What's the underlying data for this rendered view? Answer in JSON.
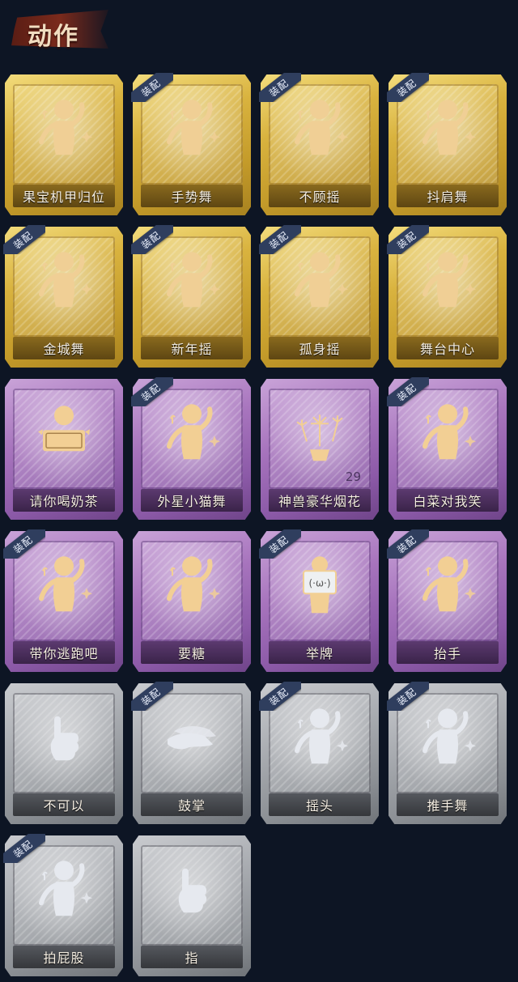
{
  "header": {
    "title": "动作"
  },
  "equip_label": "装配",
  "cards": [
    {
      "name": "果宝机甲归位",
      "tier": "gold",
      "equipped": false,
      "icon": "character-pose-icon"
    },
    {
      "name": "手势舞",
      "tier": "gold",
      "equipped": true,
      "icon": "character-dance-icon"
    },
    {
      "name": "不顾摇",
      "tier": "gold",
      "equipped": true,
      "icon": "character-point-icon"
    },
    {
      "name": "抖肩舞",
      "tier": "gold",
      "equipped": true,
      "icon": "character-shrug-icon"
    },
    {
      "name": "金城舞",
      "tier": "gold",
      "equipped": true,
      "icon": "character-wave-icon"
    },
    {
      "name": "新年摇",
      "tier": "gold",
      "equipped": true,
      "icon": "character-sway-icon"
    },
    {
      "name": "孤身摇",
      "tier": "gold",
      "equipped": true,
      "icon": "character-solo-icon"
    },
    {
      "name": "舞台中心",
      "tier": "gold",
      "equipped": true,
      "icon": "character-stage-icon"
    },
    {
      "name": "请你喝奶茶",
      "tier": "purple",
      "equipped": false,
      "icon": "character-sign-icon"
    },
    {
      "name": "外星小猫舞",
      "tier": "purple",
      "equipped": true,
      "icon": "character-cat-icon"
    },
    {
      "name": "神兽豪华烟花",
      "tier": "purple",
      "equipped": false,
      "icon": "fireworks-icon",
      "count": "29"
    },
    {
      "name": "白菜对我笑",
      "tier": "purple",
      "equipped": true,
      "icon": "character-smile-icon"
    },
    {
      "name": "带你逃跑吧",
      "tier": "purple",
      "equipped": true,
      "icon": "character-run-icon"
    },
    {
      "name": "要糖",
      "tier": "purple",
      "equipped": false,
      "icon": "character-candy-icon"
    },
    {
      "name": "举牌",
      "tier": "purple",
      "equipped": true,
      "icon": "character-placard-icon"
    },
    {
      "name": "抬手",
      "tier": "purple",
      "equipped": true,
      "icon": "character-raise-hand-icon"
    },
    {
      "name": "不可以",
      "tier": "gray",
      "equipped": false,
      "icon": "finger-wag-icon"
    },
    {
      "name": "鼓掌",
      "tier": "gray",
      "equipped": true,
      "icon": "clapping-hands-icon"
    },
    {
      "name": "摇头",
      "tier": "gray",
      "equipped": true,
      "icon": "character-shake-head-icon"
    },
    {
      "name": "推手舞",
      "tier": "gray",
      "equipped": true,
      "icon": "character-push-icon"
    },
    {
      "name": "拍屁股",
      "tier": "gray",
      "equipped": true,
      "icon": "character-pat-icon"
    },
    {
      "name": "指",
      "tier": "gray",
      "equipped": false,
      "icon": "pointing-hand-icon"
    }
  ]
}
